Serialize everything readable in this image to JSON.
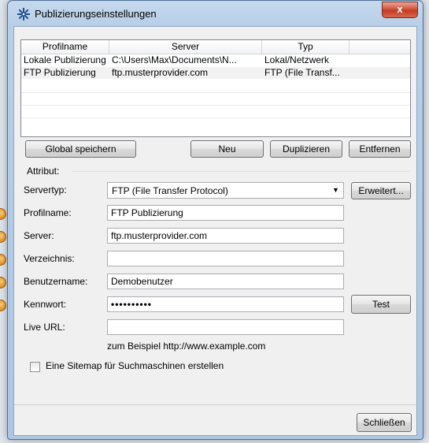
{
  "window": {
    "title": "Publizierungseinstellungen",
    "close_label": "x"
  },
  "profiles": {
    "columns": [
      "Profilname",
      "Server",
      "Typ"
    ],
    "rows": [
      [
        "Lokale Publizierung",
        "C:\\Users\\Max\\Documents\\N...",
        "Lokal/Netzwerk"
      ],
      [
        "FTP Publizierung",
        "ftp.musterprovider.com",
        "FTP (File Transf..."
      ]
    ],
    "selected_row": 1
  },
  "buttons": {
    "global_save": "Global speichern",
    "new": "Neu",
    "duplicate": "Duplizieren",
    "remove": "Entfernen",
    "advanced": "Erweitert...",
    "test": "Test",
    "close": "Schließen"
  },
  "attributes": {
    "group_label": "Attribut:",
    "servertype_label": "Servertyp:",
    "servertype_value": "FTP (File Transfer Protocol)",
    "profilename_label": "Profilname:",
    "profilename_value": "FTP Publizierung",
    "server_label": "Server:",
    "server_value": "ftp.musterprovider.com",
    "directory_label": "Verzeichnis:",
    "directory_value": "",
    "username_label": "Benutzername:",
    "username_value": "Demobenutzer",
    "password_label": "Kennwort:",
    "password_value": "••••••••••",
    "liveurl_label": "Live URL:",
    "liveurl_value": "",
    "liveurl_hint": "zum Beispiel http://www.example.com"
  },
  "sitemap": {
    "label": "Eine Sitemap für Suchmaschinen erstellen",
    "checked": false
  },
  "colors": {
    "titlebar": "#b9cfe7",
    "close": "#c23b22",
    "marker": "#e08a1a"
  }
}
